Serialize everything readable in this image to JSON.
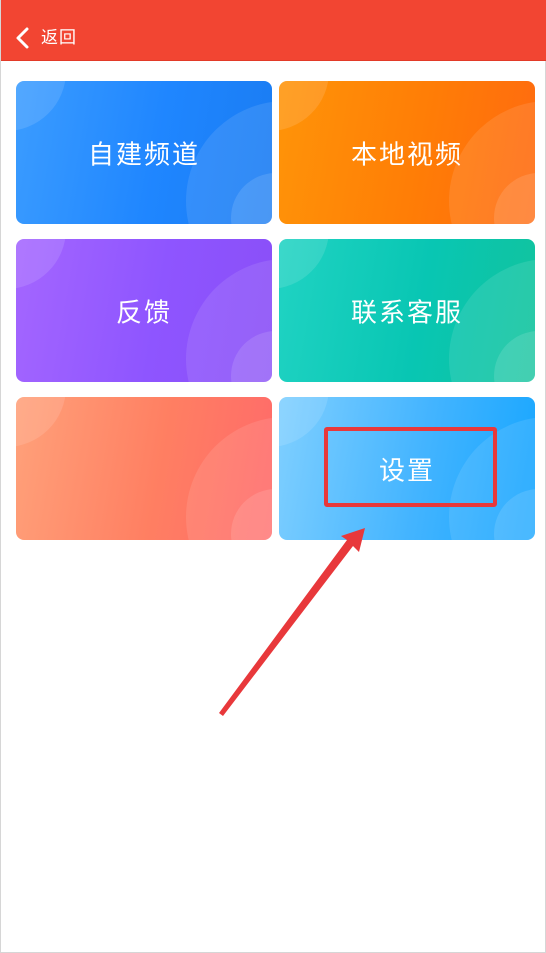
{
  "header": {
    "back_label": "返回",
    "color": "#f24532"
  },
  "tiles": [
    {
      "label": "自建频道",
      "color": "#2a8fff"
    },
    {
      "label": "本地视频",
      "color": "#ff7f05"
    },
    {
      "label": "反馈",
      "color": "#9a5cff"
    },
    {
      "label": "联系客服",
      "color": "#0ccbb2"
    },
    {
      "label": "",
      "color": "#ff8a6a"
    },
    {
      "label": "设置",
      "color": "#3fb4ff"
    }
  ],
  "annotation": {
    "highlight_color": "#e8383b",
    "arrow_color": "#e8383b"
  }
}
